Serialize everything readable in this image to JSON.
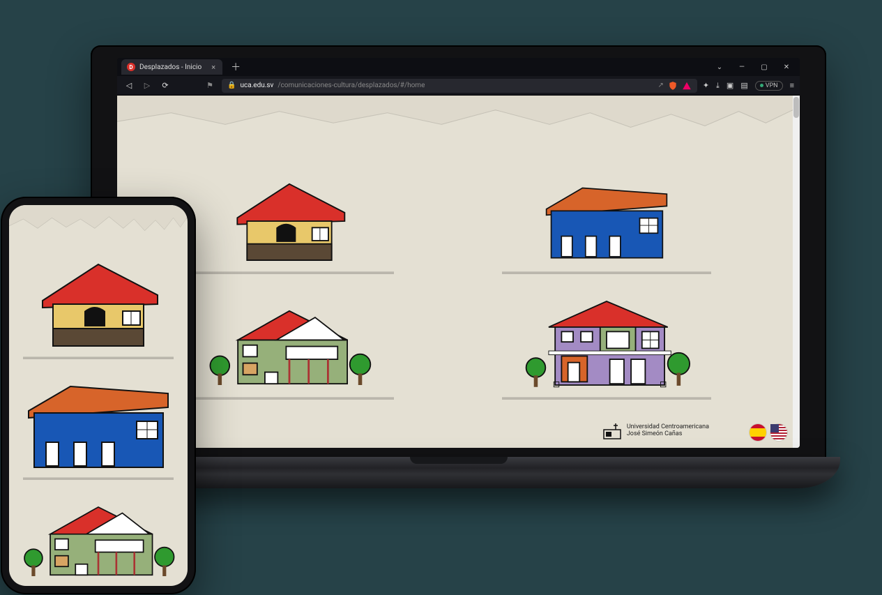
{
  "browser": {
    "tab": {
      "title": "Desplazados - Inicio",
      "favicon_letter": "D"
    },
    "window_controls": {
      "dropdown": "⌄",
      "minimize": "—",
      "maximize": "▢",
      "close": "✕"
    },
    "nav": {
      "back": "◁",
      "forward": "▷",
      "reload": "⟳"
    },
    "bookmark_icon": "⚑",
    "lock_icon": "🔒",
    "url_domain": "uca.edu.sv",
    "url_path": "/comunicaciones-cultura/desplazados/#/home",
    "share_icon": "↗",
    "extensions": {
      "puzzle": "✦",
      "download": "⤓",
      "panel": "▣",
      "wallet": "▤",
      "vpn_label": "VPN",
      "menu": "≡"
    }
  },
  "page": {
    "footer": {
      "line1": "Universidad Centroamericana",
      "line2": "José Simeón Cañas"
    },
    "languages": {
      "es": "Español",
      "en": "English"
    },
    "houses": [
      {
        "id": "house-yellow"
      },
      {
        "id": "house-blue"
      },
      {
        "id": "house-green"
      },
      {
        "id": "house-purple"
      }
    ]
  },
  "colors": {
    "page_bg": "#e4e0d3",
    "red_roof": "#d9302a",
    "orange_roof": "#d7642a",
    "yellow_wall": "#e8c86a",
    "blue_wall": "#1857b5",
    "green_wall": "#96b07a",
    "purple_wall": "#a38bc4",
    "tree_green": "#2f9a2f"
  }
}
